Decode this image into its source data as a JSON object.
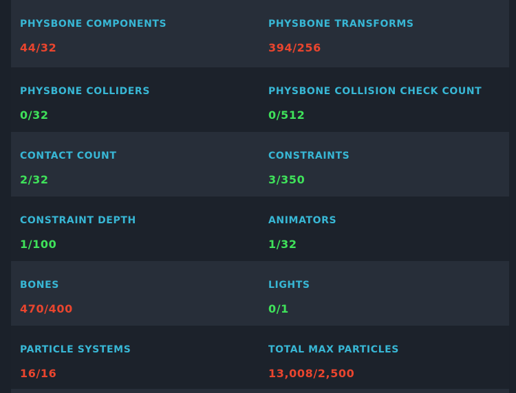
{
  "colors": {
    "label": "#38b7d5",
    "over_limit": "#e9452e",
    "within_limit": "#3fe25a"
  },
  "rows": [
    {
      "left": {
        "label": "PHYSBONE COMPONENTS",
        "value": "44/32",
        "status": "over"
      },
      "right": {
        "label": "PHYSBONE TRANSFORMS",
        "value": "394/256",
        "status": "over"
      }
    },
    {
      "left": {
        "label": "PHYSBONE COLLIDERS",
        "value": "0/32",
        "status": "ok"
      },
      "right": {
        "label": "PHYSBONE COLLISION CHECK COUNT",
        "value": "0/512",
        "status": "ok"
      }
    },
    {
      "left": {
        "label": "CONTACT COUNT",
        "value": "2/32",
        "status": "ok"
      },
      "right": {
        "label": "CONSTRAINTS",
        "value": "3/350",
        "status": "ok"
      }
    },
    {
      "left": {
        "label": "CONSTRAINT DEPTH",
        "value": "1/100",
        "status": "ok"
      },
      "right": {
        "label": "ANIMATORS",
        "value": "1/32",
        "status": "ok"
      }
    },
    {
      "left": {
        "label": "BONES",
        "value": "470/400",
        "status": "over"
      },
      "right": {
        "label": "LIGHTS",
        "value": "0/1",
        "status": "ok"
      }
    },
    {
      "left": {
        "label": "PARTICLE SYSTEMS",
        "value": "16/16",
        "status": "over"
      },
      "right": {
        "label": "TOTAL MAX PARTICLES",
        "value": "13,008/2,500",
        "status": "over"
      }
    }
  ]
}
